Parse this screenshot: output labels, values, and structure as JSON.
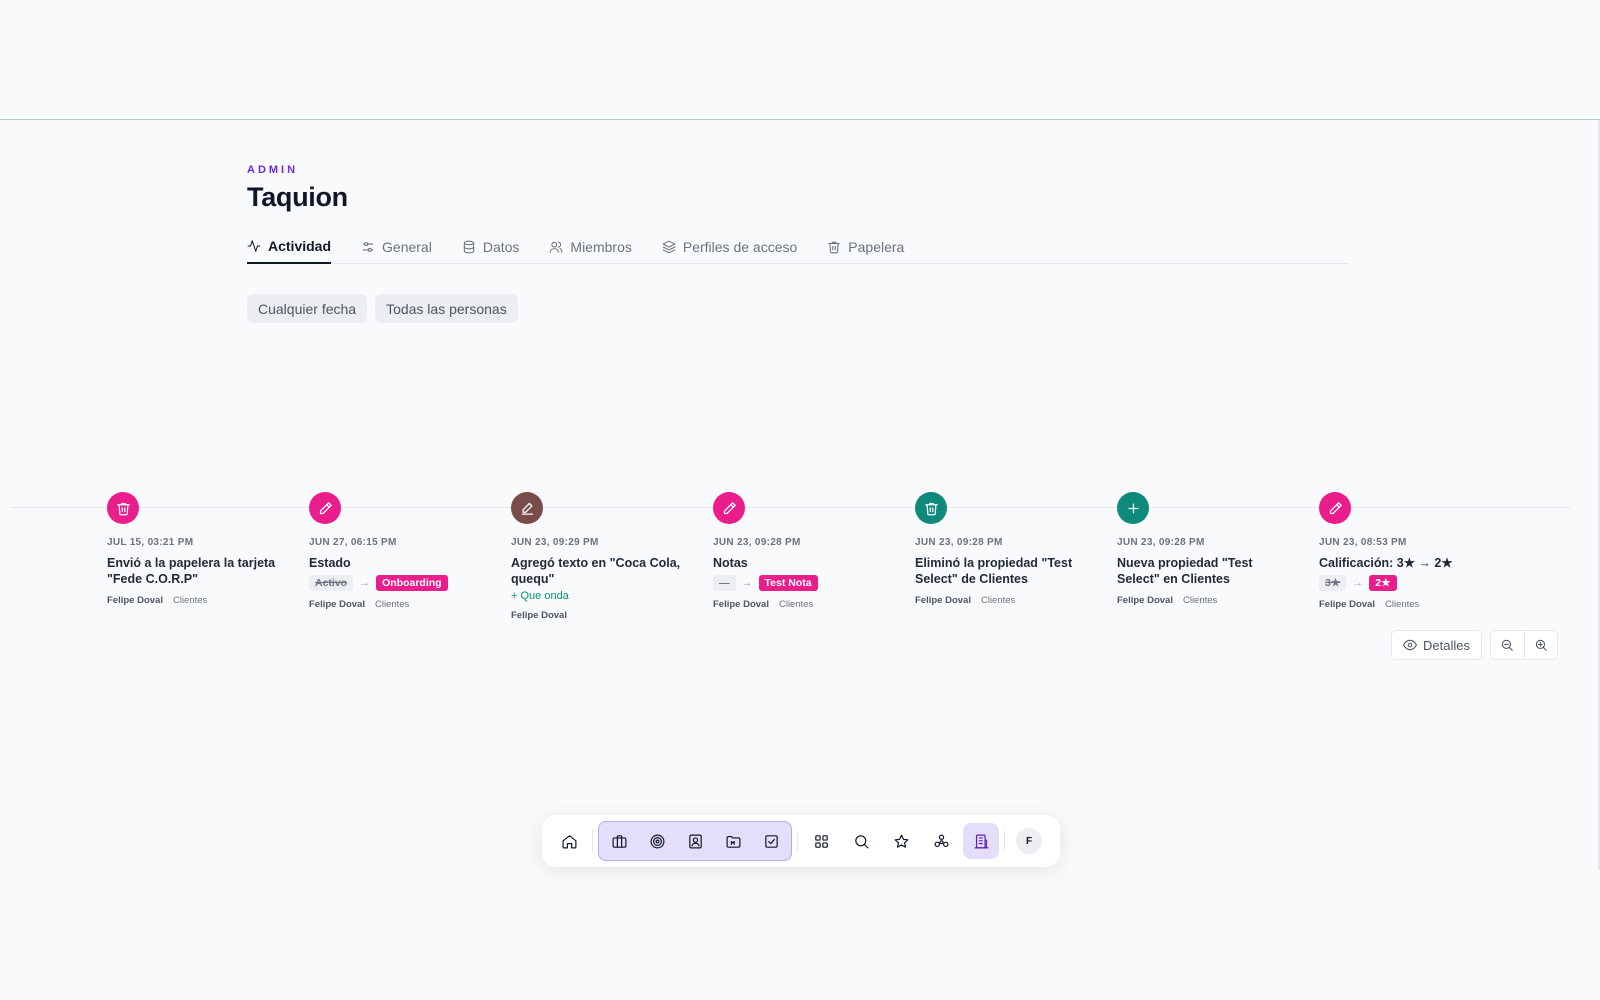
{
  "header": {
    "eyebrow": "ADMIN",
    "title": "Taquion"
  },
  "tabs": [
    {
      "label": "Actividad",
      "icon": "activity-icon",
      "active": true
    },
    {
      "label": "General",
      "icon": "sliders-icon",
      "active": false
    },
    {
      "label": "Datos",
      "icon": "database-icon",
      "active": false
    },
    {
      "label": "Miembros",
      "icon": "users-icon",
      "active": false
    },
    {
      "label": "Perfiles de acceso",
      "icon": "layers-icon",
      "active": false
    },
    {
      "label": "Papelera",
      "icon": "trash-icon",
      "active": false
    }
  ],
  "filters": {
    "date": "Cualquier fecha",
    "people": "Todas las personas"
  },
  "events": [
    {
      "icon": "trash-icon",
      "color": "#e91e8c",
      "date": "JUL 15, 03:21 PM",
      "title": "Envió a la papelera la tarjeta \"Fede C.O.R.P\"",
      "user": "Felipe Doval",
      "module": "Clientes"
    },
    {
      "icon": "pencil-icon",
      "color": "#e91e8c",
      "date": "JUN 27, 06:15 PM",
      "title": "Estado",
      "old_value": "Activo",
      "arrow": "→",
      "new_value": "Onboarding",
      "user": "Felipe Doval",
      "module": "Clientes"
    },
    {
      "icon": "edit-text-icon",
      "color": "#7a4b4b",
      "date": "JUN 23, 09:29 PM",
      "title": "Agregó texto en \"Coca Cola, quequ\"",
      "added_text": "+ Que onda",
      "user": "Felipe Doval"
    },
    {
      "icon": "pencil-icon",
      "color": "#e91e8c",
      "date": "JUN 23, 09:28 PM",
      "title": "Notas",
      "old_value": "—",
      "arrow": "→",
      "new_value": "Test Nota",
      "user": "Felipe Doval",
      "module": "Clientes"
    },
    {
      "icon": "trash-icon",
      "color": "#0f8a7a",
      "date": "JUN 23, 09:28 PM",
      "title": "Eliminó la propiedad \"Test Select\" de Clientes",
      "user": "Felipe Doval",
      "module": "Clientes"
    },
    {
      "icon": "plus-icon",
      "color": "#0f8a7a",
      "date": "JUN 23, 09:28 PM",
      "title": "Nueva propiedad \"Test Select\" en Clientes",
      "user": "Felipe Doval",
      "module": "Clientes"
    },
    {
      "icon": "pencil-icon",
      "color": "#e91e8c",
      "date": "JUN 23, 08:53 PM",
      "title": "Calificación: 3★ → 2★",
      "old_value": "3★",
      "arrow": "→",
      "new_value": "2★",
      "user": "Felipe Doval",
      "module": "Clientes"
    }
  ],
  "controls": {
    "details_label": "Detalles"
  },
  "dock": {
    "avatar_initial": "F",
    "items": [
      "home-icon",
      "briefcase-icon",
      "target-icon",
      "contact-icon",
      "folder-icon",
      "check-square-icon",
      "grid-icon",
      "search-icon",
      "star-icon",
      "network-icon",
      "building-icon"
    ]
  }
}
